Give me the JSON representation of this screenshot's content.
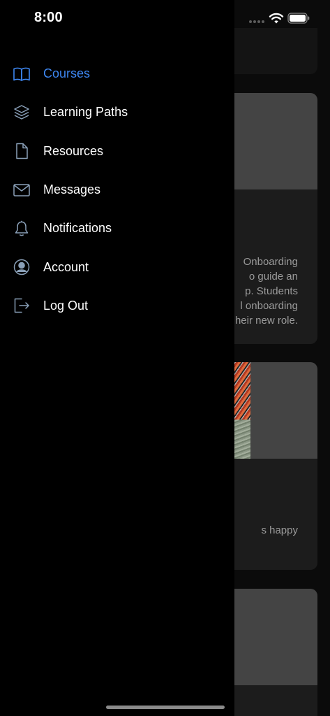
{
  "status_bar": {
    "time": "8:00"
  },
  "drawer": {
    "items": [
      {
        "label": "Courses",
        "icon": "book-open-icon",
        "active": true
      },
      {
        "label": "Learning Paths",
        "icon": "layers-icon",
        "active": false
      },
      {
        "label": "Resources",
        "icon": "file-icon",
        "active": false
      },
      {
        "label": "Messages",
        "icon": "mail-icon",
        "active": false
      },
      {
        "label": "Notifications",
        "icon": "bell-icon",
        "active": false
      },
      {
        "label": "Account",
        "icon": "user-circle-icon",
        "active": false
      },
      {
        "label": "Log Out",
        "icon": "log-out-icon",
        "active": false
      }
    ]
  },
  "background_cards": [
    {
      "description_visible": "Onboarding\no guide an\np. Students\nl onboarding\nheir new role."
    },
    {
      "description_visible": "s happy"
    }
  ],
  "colors": {
    "accent": "#3d86f0",
    "drawer_bg": "#000000",
    "card_bg": "#1c1c1c",
    "card_image_placeholder": "#444444"
  }
}
